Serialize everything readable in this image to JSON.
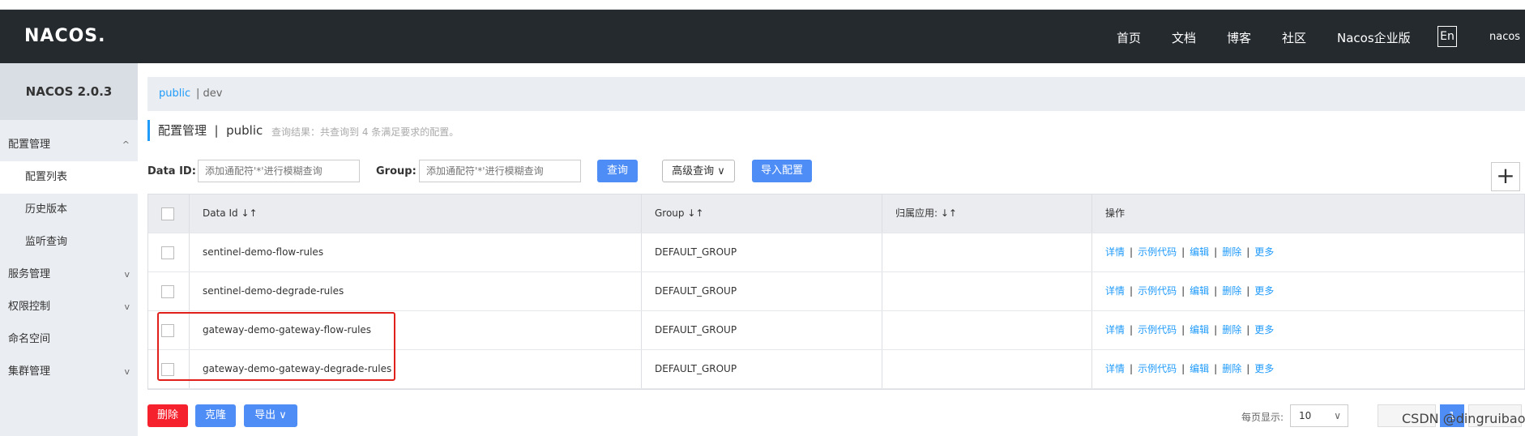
{
  "header": {
    "logo": "NACOS.",
    "nav": [
      "首页",
      "文档",
      "博客",
      "社区",
      "Nacos企业版"
    ],
    "lang": "En",
    "user": "nacos"
  },
  "sidebar": {
    "version": "NACOS 2.0.3",
    "items": [
      {
        "label": "配置管理",
        "chevron": "^"
      },
      {
        "label": "配置列表"
      },
      {
        "label": "历史版本"
      },
      {
        "label": "监听查询"
      },
      {
        "label": "服务管理",
        "chevron": "v"
      },
      {
        "label": "权限控制",
        "chevron": "v"
      },
      {
        "label": "命名空间"
      },
      {
        "label": "集群管理",
        "chevron": "v"
      }
    ]
  },
  "breadcrumb": {
    "namespace": "public",
    "other": "| dev"
  },
  "title": {
    "main": "配置管理  |  public",
    "hint": "查询结果：共查询到 4 条满足要求的配置。"
  },
  "search": {
    "data_id_label": "Data ID:",
    "data_id_placeholder": "添加通配符'*'进行模糊查询",
    "group_label": "Group:",
    "group_placeholder": "添加通配符'*'进行模糊查询",
    "query_btn": "查询",
    "advanced_btn": "高级查询 ∨",
    "import_btn": "导入配置",
    "plus": "+"
  },
  "table": {
    "headers": [
      "Data Id ↓↑",
      "Group ↓↑",
      "归属应用: ↓↑",
      "操作"
    ],
    "rows": [
      {
        "data_id": "sentinel-demo-flow-rules",
        "group": "DEFAULT_GROUP",
        "app": ""
      },
      {
        "data_id": "sentinel-demo-degrade-rules",
        "group": "DEFAULT_GROUP",
        "app": ""
      },
      {
        "data_id": "gateway-demo-gateway-flow-rules",
        "group": "DEFAULT_GROUP",
        "app": ""
      },
      {
        "data_id": "gateway-demo-gateway-degrade-rules",
        "group": "DEFAULT_GROUP",
        "app": ""
      }
    ],
    "ops": [
      "详情",
      "示例代码",
      "编辑",
      "删除",
      "更多"
    ]
  },
  "bottom": {
    "delete_btn": "删除",
    "clone_btn": "克隆",
    "export_btn": "导出 ∨",
    "page_size_label": "每页显示:",
    "page_size": "10",
    "current_page": "1"
  },
  "watermark": "CSDN @dingruibao",
  "colors": {
    "accent": "#209bfa",
    "topbar": "#252a2f",
    "danger": "#f5222d",
    "highlight": "#e0201a"
  }
}
